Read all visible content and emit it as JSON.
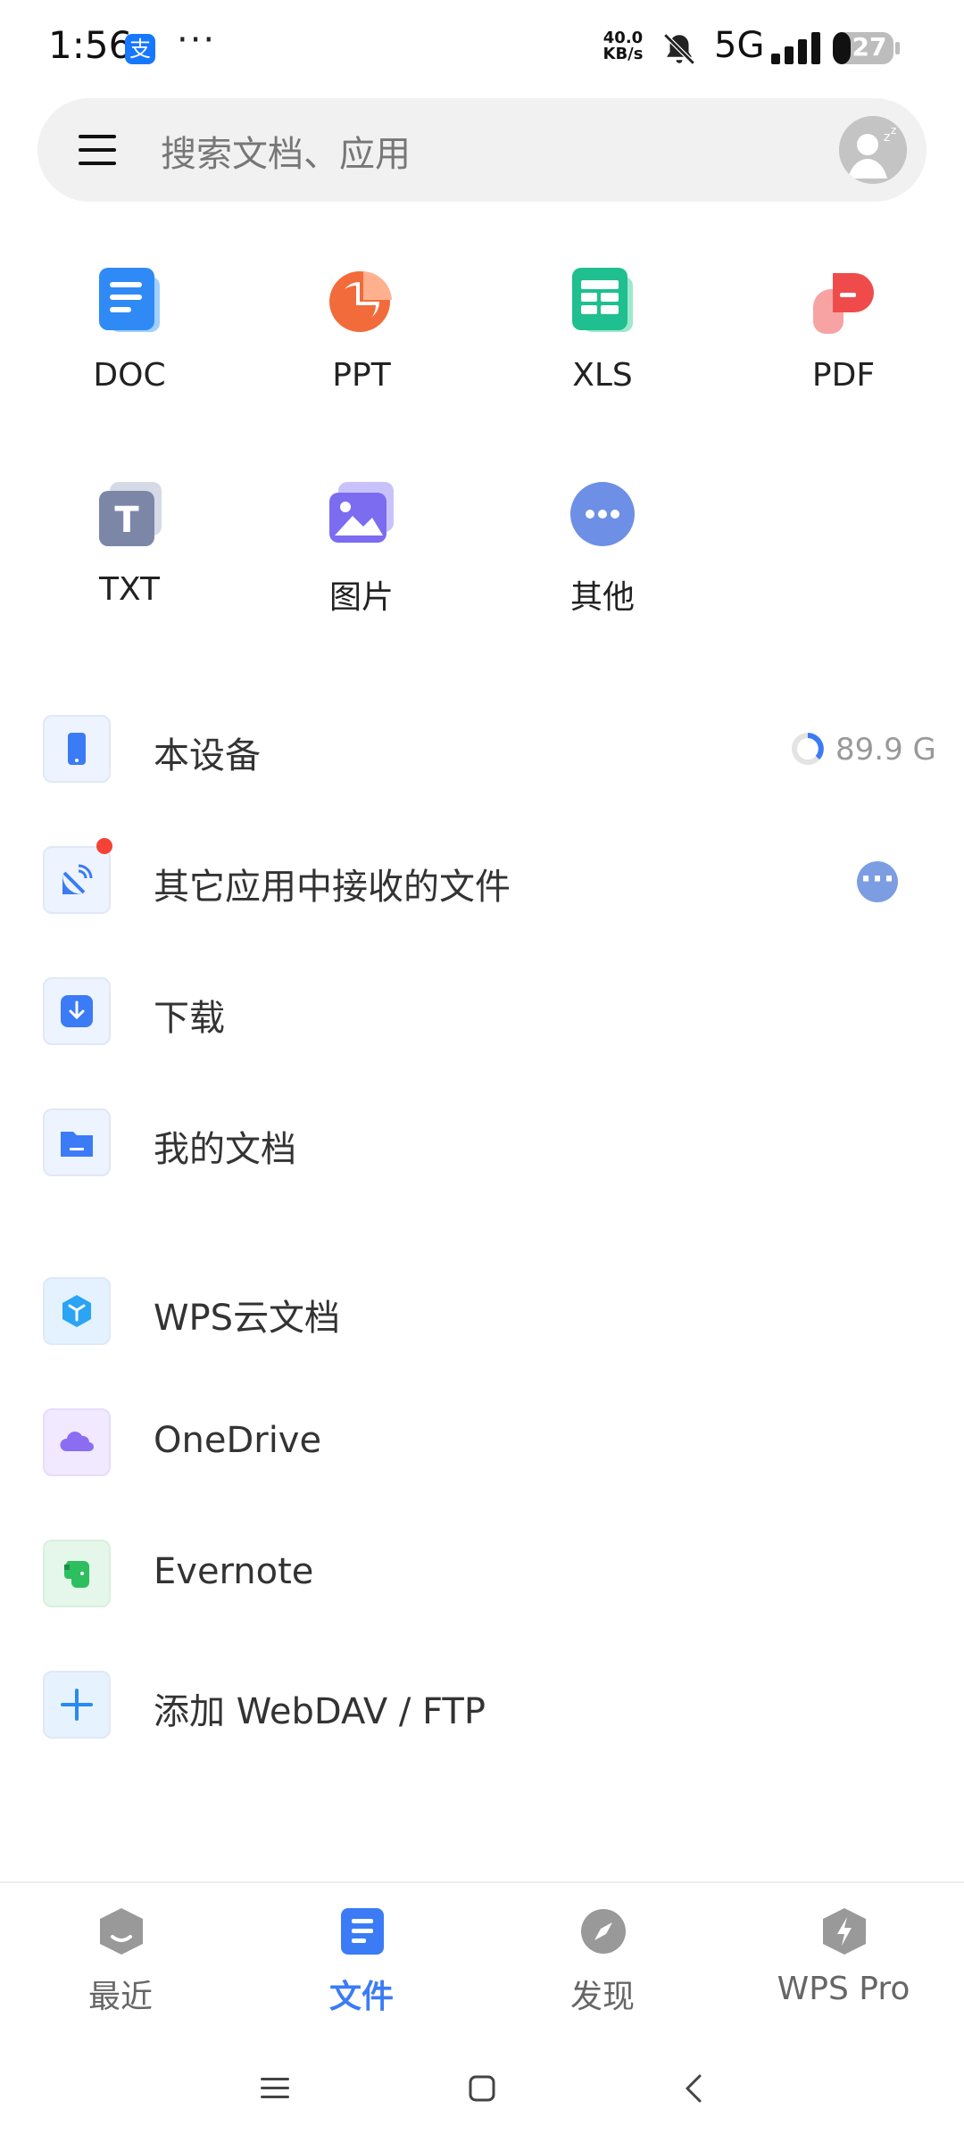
{
  "status_bar": {
    "time": "1:56",
    "dots": "···",
    "net_speed_value": "40.0",
    "net_speed_unit": "KB/s",
    "network": "5G",
    "battery": "27"
  },
  "search": {
    "placeholder": "搜索文档、应用"
  },
  "file_types": [
    {
      "label": "DOC",
      "icon": "doc-icon",
      "color": "#2f8af5"
    },
    {
      "label": "PPT",
      "icon": "ppt-icon",
      "color": "#f26b3a"
    },
    {
      "label": "XLS",
      "icon": "xls-icon",
      "color": "#1fbf8f"
    },
    {
      "label": "PDF",
      "icon": "pdf-icon",
      "color": "#f04b4b"
    },
    {
      "label": "TXT",
      "icon": "txt-icon",
      "color": "#7c87a8"
    },
    {
      "label": "图片",
      "icon": "image-icon",
      "color": "#7b6cf0"
    },
    {
      "label": "其他",
      "icon": "more-icon",
      "color": "#6d8fe6"
    }
  ],
  "storage": [
    {
      "label": "本设备",
      "icon": "phone-icon",
      "extra": "89.9 G"
    },
    {
      "label": "其它应用中接收的文件",
      "icon": "satellite-icon"
    },
    {
      "label": "下载",
      "icon": "download-icon"
    },
    {
      "label": "我的文档",
      "icon": "folder-icon"
    },
    {
      "label": "WPS云文档",
      "icon": "cloud-box-icon"
    },
    {
      "label": "OneDrive",
      "icon": "onedrive-icon"
    },
    {
      "label": "Evernote",
      "icon": "evernote-icon"
    },
    {
      "label": "添加 WebDAV / FTP",
      "icon": "plus-icon"
    }
  ],
  "bottom_nav": [
    {
      "label": "最近",
      "icon": "recent-icon"
    },
    {
      "label": "文件",
      "icon": "files-icon",
      "active": true
    },
    {
      "label": "发现",
      "icon": "compass-icon"
    },
    {
      "label": "WPS Pro",
      "icon": "wps-pro-icon"
    }
  ],
  "colors": {
    "accent": "#3b7bf6",
    "search_bg": "#f1f1f1"
  }
}
